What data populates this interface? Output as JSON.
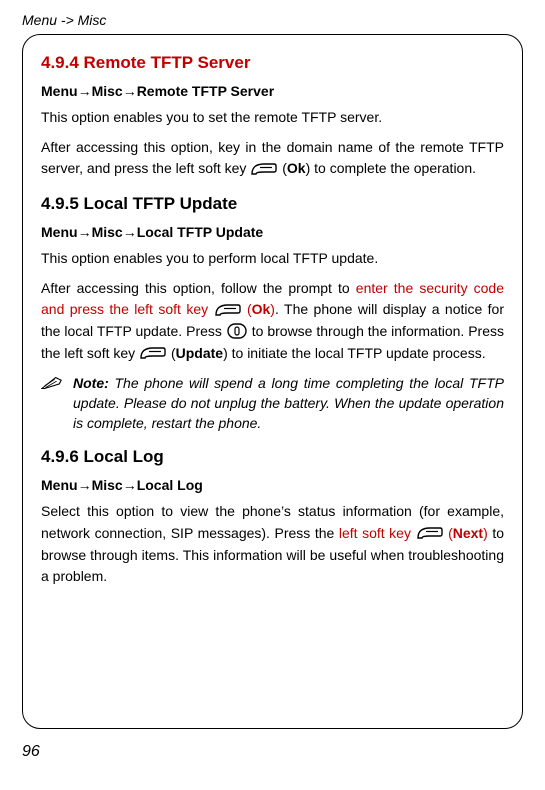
{
  "header": "Menu -> Misc",
  "section494": {
    "title": "4.9.4 Remote TFTP Server",
    "path_pre": "Menu",
    "path_mid": "Misc",
    "path_end": "Remote TFTP Server",
    "p1": "This option enables you to set the remote TFTP server.",
    "p2a": "After accessing this option, key in the domain name of the remote TFTP server, and press the left soft key ",
    "p2b": " (",
    "p2ok": "Ok",
    "p2c": ") to complete the operation."
  },
  "section495": {
    "title": "4.9.5 Local TFTP Update",
    "path_pre": "Menu",
    "path_mid": "Misc",
    "path_end": "Local TFTP Update",
    "p1": "This option enables you to perform local TFTP update.",
    "p2a": "After accessing this option, follow the prompt to ",
    "p2red1": "enter the security code and press the left soft key ",
    "p2b": " (",
    "p2ok": "Ok",
    "p2c": "). The phone will display a notice for the local TFTP update. Press ",
    "p2d": " to browse through the information. Press the left soft key ",
    "p2e": " (",
    "p2upd": "Update",
    "p2f": ") to initiate the local TFTP update process.",
    "note_label": "Note:",
    "note_text": " The phone will spend a long time completing the local TFTP update. Please do not unplug the battery. When the update operation is complete, restart the phone."
  },
  "section496": {
    "title": "4.9.6 Local Log",
    "path_pre": "Menu",
    "path_mid": "Misc",
    "path_end": "Local Log",
    "p1a": "Select this option to view the phone’s status information (for example, network connection, SIP messages). Press the ",
    "p1red": "left soft key ",
    "p1b": " (",
    "p1next": "Next",
    "p1c": ") to browse through items. This information will be useful when troubleshooting a problem."
  },
  "pagenum": "96"
}
